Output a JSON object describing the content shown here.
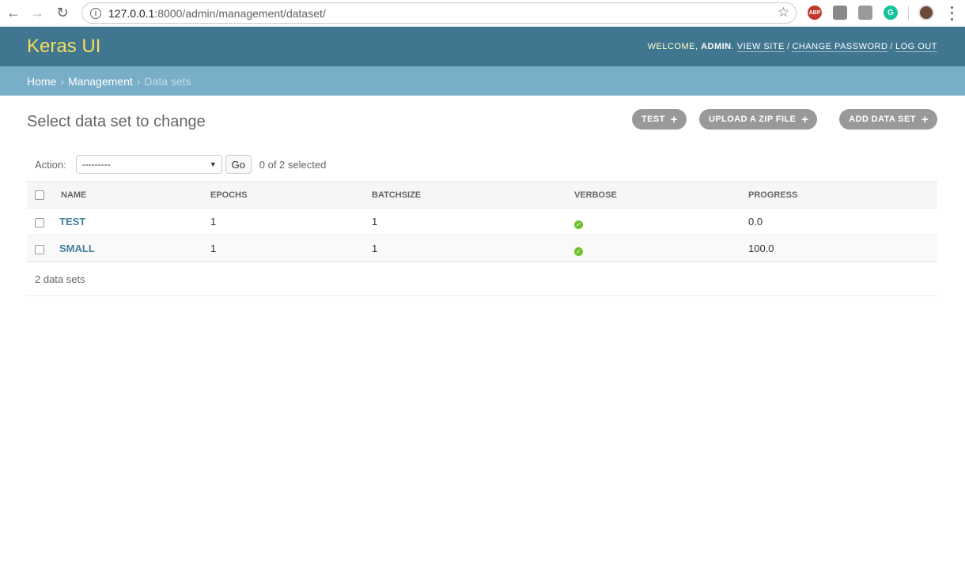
{
  "browser": {
    "url_host": "127.0.0.1",
    "url_rest": ":8000/admin/management/dataset/",
    "ext_abp": "ABP"
  },
  "header": {
    "brand": "Keras UI",
    "welcome": "WELCOME, ",
    "user": "ADMIN",
    "view_site": "VIEW SITE",
    "change_password": "CHANGE PASSWORD",
    "logout": "LOG OUT"
  },
  "breadcrumbs": {
    "home": "Home",
    "management": "Management",
    "current": "Data sets"
  },
  "page": {
    "title": "Select data set to change"
  },
  "object_tools": {
    "test": "TEST",
    "upload": "UPLOAD A ZIP FILE",
    "add": "ADD DATA SET"
  },
  "actions": {
    "label": "Action:",
    "selected": "---------",
    "go": "Go",
    "counter": "0 of 2 selected"
  },
  "table": {
    "headers": [
      "NAME",
      "EPOCHS",
      "BATCHSIZE",
      "VERBOSE",
      "PROGRESS"
    ],
    "rows": [
      {
        "name": "TEST",
        "epochs": "1",
        "batchsize": "1",
        "verbose": true,
        "progress": "0.0"
      },
      {
        "name": "SMALL",
        "epochs": "1",
        "batchsize": "1",
        "verbose": true,
        "progress": "100.0"
      }
    ]
  },
  "paginator": "2 data sets",
  "colors": {
    "header": "#417690",
    "breadcrumbs": "#79aec8",
    "brand": "#f5dd5d",
    "link": "#447e9b",
    "yes": "#70bf2b"
  }
}
